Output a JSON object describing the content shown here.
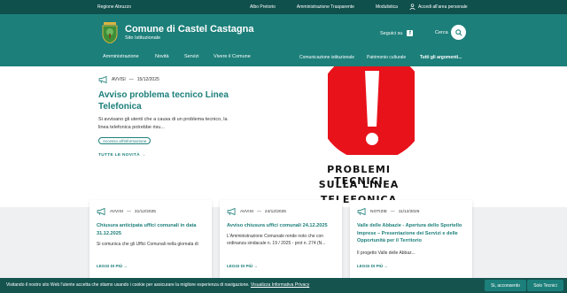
{
  "topbar": {
    "region": "Regione Abruzzo",
    "links": [
      "Albo Pretorio",
      "Amministrazione Trasparente",
      "Modulistica"
    ],
    "access": "Accedi all'area personale"
  },
  "header": {
    "title": "Comune di Castel Castagna",
    "subtitle": "Sito Istituzionale",
    "follow": "Seguici su",
    "search": "Cerca"
  },
  "nav": {
    "main": [
      "Amministrazione",
      "Novità",
      "Servizi",
      "Vivere il Comune"
    ],
    "secondary": [
      "Comunicazione istituzionale",
      "Patrimonio culturale",
      "Tutti gli argomenti..."
    ]
  },
  "hero": {
    "tag": "AVVISI",
    "date": "15/12/2025",
    "title": "Avviso problema tecnico Linea Telefonica",
    "description": "Si avvisano gli utenti che a causa di un problema tecnico, la linea telefonica potrebbe risu...",
    "chip": "Accesso all'informazione",
    "all_news": "TUTTE LE NOVITÀ",
    "image_caption": [
      "PROBLEMI TECNICI",
      "SULLA LINEA",
      "TELEFONICA"
    ],
    "accent": "#e8121b"
  },
  "cards": [
    {
      "tag": "AVVISI",
      "date": "31/12/2025",
      "title": "Chiusura anticipata uffici comunali in data 31.12.2025",
      "description": "Si comunica che gli Uffici Comunali nella giornata di",
      "more": "LEGGI DI PIÙ"
    },
    {
      "tag": "AVVISI",
      "date": "24/12/2025",
      "title": "Avviso chiusura uffici comunali 24.12.2025",
      "description": "L'Amministrazione Comunale rende noto che con ordinanza sindacale n. 19 / 2025 - prot n. 274 (N...",
      "more": "LEGGI DI PIÙ"
    },
    {
      "tag": "NOTIZIE",
      "date": "11/12/2025",
      "title": "Valle delle Abbazie - Apertura dello Sportello Imprese – Presentazione dei Servizi e delle Opportunità per il Territorio",
      "description": "Il progetto Valle delle Abbaz...",
      "more": "LEGGI DI PIÙ"
    }
  ],
  "cookie": {
    "text": "Visitando il nostro sito Web l'utente accetta che stiamo usando i cookie per assicurare la migliore esperienza di navigazione.",
    "link": "Visualizza Informativa Privacy",
    "accept": "Si, acconsento",
    "only": "Solo Tecnici"
  },
  "colors": {
    "primary": "#1c7f7a",
    "dark": "#0f4f4c",
    "cookie_bg": "#15534f"
  }
}
